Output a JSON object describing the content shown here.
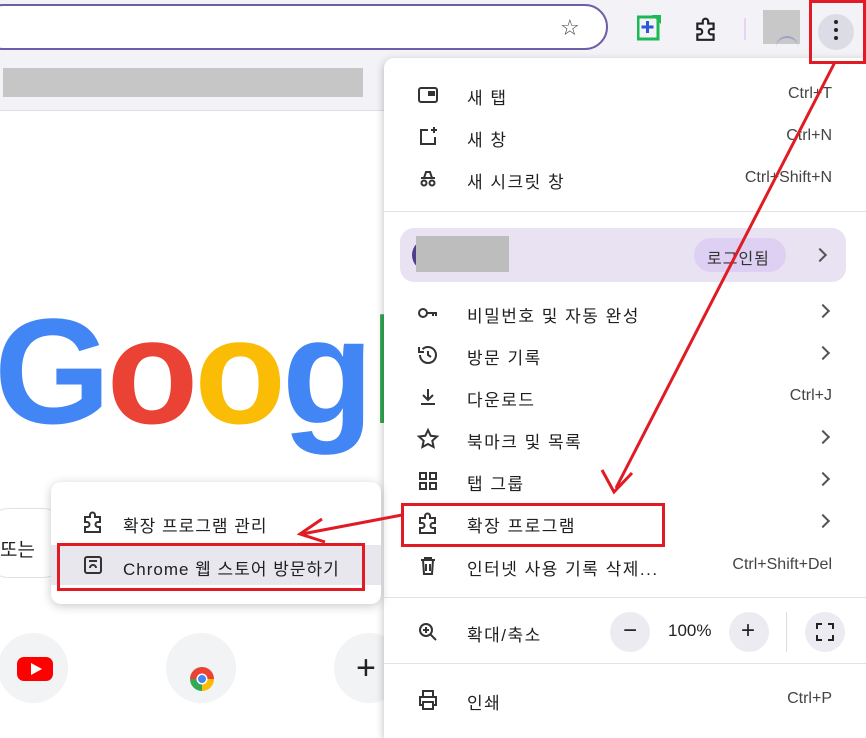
{
  "menu": {
    "items": [
      {
        "label": "새 탭",
        "shortcut": "Ctrl+T",
        "icon": "new-tab-icon"
      },
      {
        "label": "새 창",
        "shortcut": "Ctrl+N",
        "icon": "new-window-icon"
      },
      {
        "label": "새 시크릿 창",
        "shortcut": "Ctrl+Shift+N",
        "icon": "incognito-icon"
      },
      {
        "label": "비밀번호 및 자동 완성",
        "icon": "key-icon"
      },
      {
        "label": "방문 기록",
        "icon": "history-icon"
      },
      {
        "label": "다운로드",
        "shortcut": "Ctrl+J",
        "icon": "download-icon"
      },
      {
        "label": "북마크 및 목록",
        "icon": "star-icon"
      },
      {
        "label": "탭 그룹",
        "icon": "tab-groups-icon"
      },
      {
        "label": "확장 프로그램",
        "icon": "puzzle-icon"
      },
      {
        "label": "인터넷 사용 기록 삭제...",
        "shortcut": "Ctrl+Shift+Del",
        "icon": "trash-icon"
      },
      {
        "label": "확대/축소",
        "icon": "zoom-icon"
      },
      {
        "label": "인쇄",
        "shortcut": "Ctrl+P",
        "icon": "print-icon"
      }
    ],
    "profile": {
      "status": "로그인됨"
    },
    "zoom": {
      "minus": "−",
      "value": "100%",
      "plus": "+"
    }
  },
  "submenu": {
    "items": [
      {
        "label": "확장 프로그램 관리",
        "icon": "puzzle-icon"
      },
      {
        "label": "Chrome 웹 스토어 방문하기",
        "icon": "webstore-icon"
      }
    ]
  },
  "page": {
    "logo": "Google",
    "search_fragment": "또는",
    "add_shortcut": "+"
  },
  "colors": {
    "annotation": "#e01b24",
    "google_blue": "#4285f4",
    "google_red": "#ea4335",
    "google_yellow": "#fbbc05",
    "google_green": "#34a853"
  }
}
